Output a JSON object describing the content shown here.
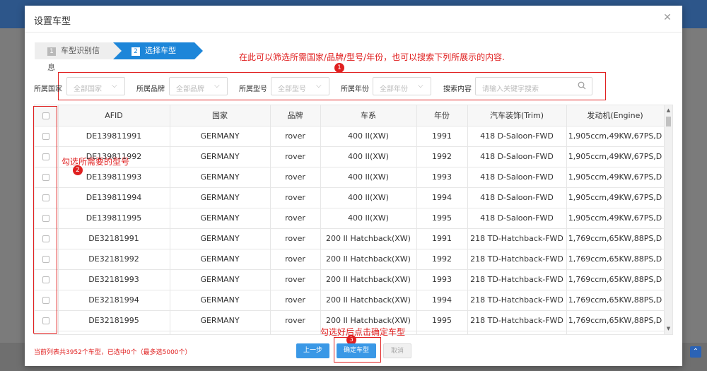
{
  "modal": {
    "title": "设置车型"
  },
  "steps": [
    {
      "num": "1",
      "label": "车型识别信息"
    },
    {
      "num": "2",
      "label": "选择车型"
    }
  ],
  "annotations": {
    "a1_text": "在此可以筛选所需国家/品牌/型号/年份，也可以搜索下列所展示的内容.",
    "a1_num": "1",
    "a2_text": "勾选所需要的型号",
    "a2_num": "2",
    "a3_text": "勾选好后点击确定车型",
    "a3_num": "3",
    "color": "#e02020"
  },
  "filters": {
    "country_label": "所属国家",
    "country_value": "全部国家",
    "brand_label": "所属品牌",
    "brand_value": "全部品牌",
    "model_label": "所属型号",
    "model_value": "全部型号",
    "year_label": "所属年份",
    "year_value": "全部年份",
    "search_label": "搜索内容",
    "search_placeholder": "请输入关键字搜索"
  },
  "table": {
    "headers": [
      "AFID",
      "国家",
      "品牌",
      "车系",
      "年份",
      "汽车装饰(Trim)",
      "发动机(Engine)"
    ],
    "rows": [
      [
        "DE139811991",
        "GERMANY",
        "rover",
        "400 II(XW)",
        "1991",
        "418 D-Saloon-FWD",
        "1,905ccm,49KW,67PS,D"
      ],
      [
        "DE139811992",
        "GERMANY",
        "rover",
        "400 II(XW)",
        "1992",
        "418 D-Saloon-FWD",
        "1,905ccm,49KW,67PS,D"
      ],
      [
        "DE139811993",
        "GERMANY",
        "rover",
        "400 II(XW)",
        "1993",
        "418 D-Saloon-FWD",
        "1,905ccm,49KW,67PS,D"
      ],
      [
        "DE139811994",
        "GERMANY",
        "rover",
        "400 II(XW)",
        "1994",
        "418 D-Saloon-FWD",
        "1,905ccm,49KW,67PS,D"
      ],
      [
        "DE139811995",
        "GERMANY",
        "rover",
        "400 II(XW)",
        "1995",
        "418 D-Saloon-FWD",
        "1,905ccm,49KW,67PS,D"
      ],
      [
        "DE32181991",
        "GERMANY",
        "rover",
        "200 II Hatchback(XW)",
        "1991",
        "218 TD-Hatchback-FWD",
        "1,769ccm,65KW,88PS,D"
      ],
      [
        "DE32181992",
        "GERMANY",
        "rover",
        "200 II Hatchback(XW)",
        "1992",
        "218 TD-Hatchback-FWD",
        "1,769ccm,65KW,88PS,D"
      ],
      [
        "DE32181993",
        "GERMANY",
        "rover",
        "200 II Hatchback(XW)",
        "1993",
        "218 TD-Hatchback-FWD",
        "1,769ccm,65KW,88PS,D"
      ],
      [
        "DE32181994",
        "GERMANY",
        "rover",
        "200 II Hatchback(XW)",
        "1994",
        "218 TD-Hatchback-FWD",
        "1,769ccm,65KW,88PS,D"
      ],
      [
        "DE32181995",
        "GERMANY",
        "rover",
        "200 II Hatchback(XW)",
        "1995",
        "218 TD-Hatchback-FWD",
        "1,769ccm,65KW,88PS,D"
      ],
      [
        "",
        "",
        "",
        "",
        "",
        "",
        ""
      ]
    ]
  },
  "footer": {
    "status": "当前列表共3952个车型，已选中0个（最多选5000个）",
    "prev_label": "上一步",
    "confirm_label": "确定车型",
    "cancel_label": "取消"
  },
  "colors": {
    "primary": "#1d86d9",
    "button": "#3a98e6",
    "annotation": "#e02020"
  }
}
